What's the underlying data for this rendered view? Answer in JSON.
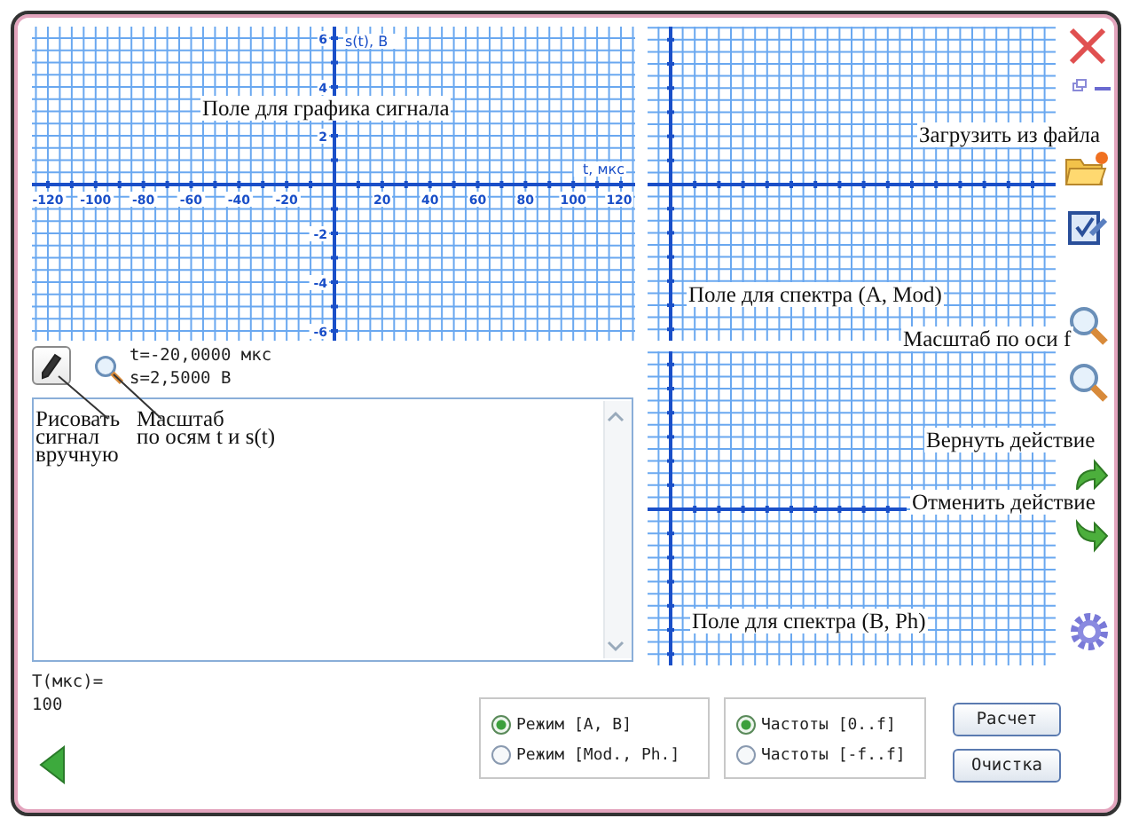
{
  "signal_plot": {
    "annotation": "Поле для графика сигнала",
    "x_axis_label": "t, мкс",
    "y_axis_label": "s(t), В",
    "x_tick_labels": [
      "-120",
      "-100",
      "-80",
      "-60",
      "-40",
      "-20",
      "20",
      "40",
      "60",
      "80",
      "100",
      "120"
    ],
    "y_tick_labels": [
      "6",
      "4",
      "2",
      "-2",
      "-4",
      "-6"
    ]
  },
  "spectrum_plots": [
    {
      "annotation": "Поле для спектра (A, Mod)"
    },
    {
      "annotation": "Поле для спектра (B, Ph)"
    }
  ],
  "toolbar": [
    {
      "kind": "close"
    },
    {
      "kind": "window"
    },
    {
      "kind": "open",
      "callout": "Загрузить из файла"
    },
    {
      "kind": "edit"
    },
    {
      "kind": "zoom"
    },
    {
      "kind": "zoom",
      "callout": "Масштаб по оси f"
    },
    {
      "kind": "redo",
      "callout": "Вернуть действие"
    },
    {
      "kind": "undo",
      "callout": "Отменить действие"
    },
    {
      "kind": "settings"
    }
  ],
  "draw_tools": [
    {
      "kind": "pencil",
      "callout": "Рисовать\nсигнал\nвручную"
    },
    {
      "kind": "zoom",
      "callout": "Масштаб\nпо осям t и s(t)"
    }
  ],
  "readouts": [
    "t=-20,0000 мкс",
    "s=2,5000 В"
  ],
  "period": {
    "label": "T(мкс)=",
    "value": "100"
  },
  "mode_options": [
    {
      "label": "Режим [A, B]",
      "selected": true
    },
    {
      "label": "Режим [Mod., Ph.]",
      "selected": false
    }
  ],
  "frequency_options": [
    {
      "label": "Частоты [0..f]",
      "selected": true
    },
    {
      "label": "Частоты [-f..f]",
      "selected": false
    }
  ],
  "buttons": [
    "Расчет",
    "Очистка"
  ]
}
